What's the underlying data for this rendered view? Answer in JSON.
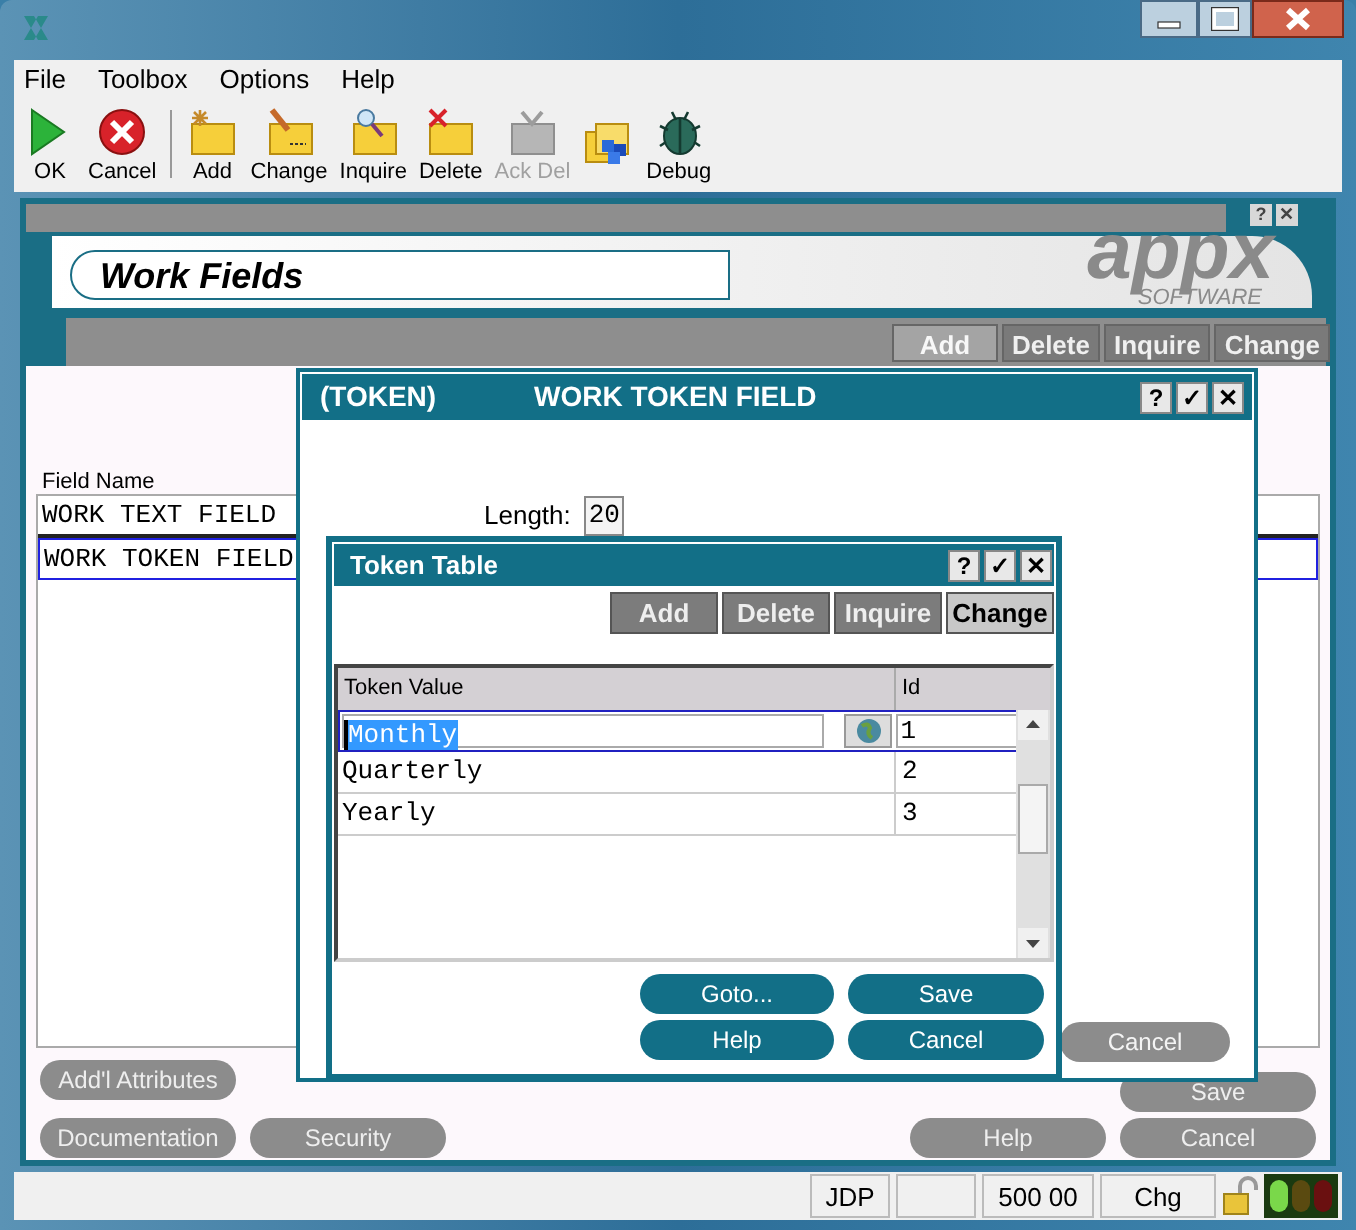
{
  "menu": [
    "File",
    "Toolbox",
    "Options",
    "Help"
  ],
  "toolbar": [
    {
      "label": "OK",
      "kind": "play",
      "disabled": false
    },
    {
      "label": "Cancel",
      "kind": "stop",
      "disabled": false
    },
    {
      "label": "Add",
      "kind": "folder-star",
      "disabled": false
    },
    {
      "label": "Change",
      "kind": "folder-pencil",
      "disabled": false
    },
    {
      "label": "Inquire",
      "kind": "folder-magnifier",
      "disabled": false
    },
    {
      "label": "Delete",
      "kind": "folder-cross",
      "disabled": false
    },
    {
      "label": "Ack Del",
      "kind": "monitor",
      "disabled": true
    },
    {
      "kind": "folders",
      "disabled": false
    },
    {
      "label": "Debug",
      "kind": "bug",
      "disabled": false
    }
  ],
  "main": {
    "title": "Work Fields",
    "corner_buttons": [
      "?",
      "✕"
    ],
    "logo": "appx",
    "logo_sub": "SOFTWARE",
    "actions": [
      {
        "label": "Add",
        "disabled": true
      },
      {
        "label": "Delete",
        "disabled": false
      },
      {
        "label": "Inquire",
        "disabled": false
      },
      {
        "label": "Change",
        "disabled": false
      }
    ],
    "column": "Field Name",
    "rows": [
      {
        "text": "WORK TEXT FIELD",
        "selected": false
      },
      {
        "text": "WORK TOKEN FIELD",
        "selected": true
      }
    ],
    "hidden_button": "Cancel",
    "buttons": [
      {
        "label": "Add'l Attributes"
      },
      {
        "label": "Save"
      },
      {
        "label": "Documentation"
      },
      {
        "label": "Security"
      },
      {
        "label": "Help"
      },
      {
        "label": "Cancel"
      }
    ]
  },
  "token_dialog": {
    "code": "(TOKEN)",
    "title": "WORK TOKEN FIELD",
    "title_buttons": [
      "?",
      "✓",
      "✕"
    ],
    "length_label": "Length:",
    "length_value": "20"
  },
  "token_table": {
    "title": "Token Table",
    "title_buttons": [
      "?",
      "✓",
      "✕"
    ],
    "actions": [
      {
        "label": "Add",
        "selected": false
      },
      {
        "label": "Delete",
        "selected": false
      },
      {
        "label": "Inquire",
        "selected": false
      },
      {
        "label": "Change",
        "selected": true
      }
    ],
    "columns": [
      "Token Value",
      "Id"
    ],
    "rows": [
      {
        "value": "Monthly",
        "id": "1",
        "selected": true
      },
      {
        "value": "Quarterly",
        "id": "2",
        "selected": false
      },
      {
        "value": "Yearly",
        "id": "3",
        "selected": false
      }
    ],
    "buttons": [
      "Goto...",
      "Save",
      "Help",
      "Cancel"
    ]
  },
  "status_bar": [
    "JDP",
    "500 00",
    "Chg"
  ]
}
